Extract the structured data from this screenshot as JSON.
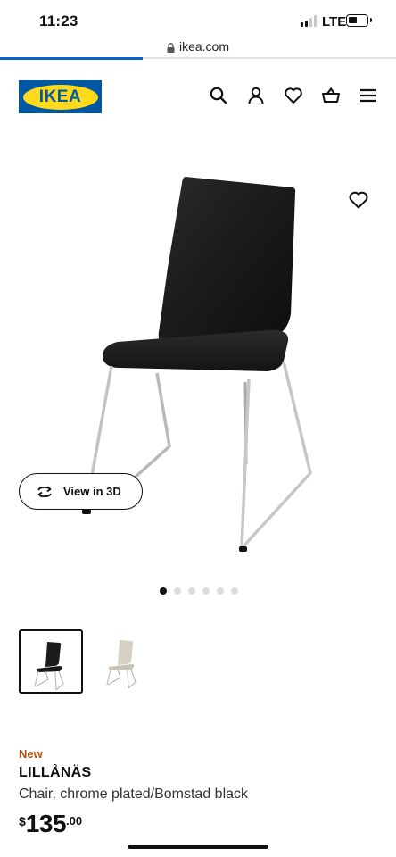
{
  "status": {
    "time": "11:23",
    "network": "LTE",
    "signal_bars": 2,
    "battery_level": 0.4
  },
  "browser": {
    "url": "ikea.com",
    "load_progress": 0.36
  },
  "header": {
    "logo_text": "IKEA",
    "icons": [
      "search-icon",
      "account-icon",
      "heart-icon",
      "cart-icon",
      "menu-icon"
    ]
  },
  "product": {
    "badge": "New",
    "name": "LILLÅNÄS",
    "description": "Chair, chrome plated/Bomstad black",
    "price": {
      "currency": "$",
      "whole": "135",
      "cents": ".00"
    }
  },
  "gallery": {
    "view_3d_label": "View in 3D",
    "image_count": 6,
    "active_index": 0
  },
  "variants": [
    {
      "color": "Bomstad black",
      "selected": true
    },
    {
      "color": "Bomstad beige",
      "selected": false
    }
  ],
  "colors": {
    "ikea_blue": "#0058a3",
    "ikea_yellow": "#ffda1a",
    "new_badge": "#b84d10",
    "progress": "#0a63c9"
  }
}
